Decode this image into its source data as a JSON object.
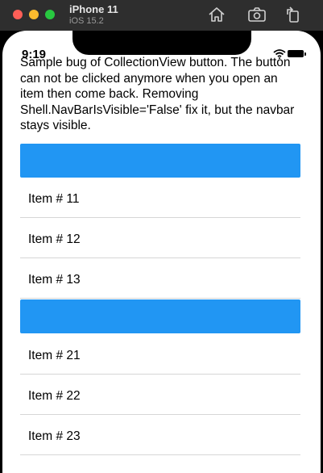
{
  "simulator": {
    "device_name": "iPhone 11",
    "os_version": "iOS 15.2",
    "toolbar_icons": [
      "home-icon",
      "screenshot-icon",
      "rotate-icon"
    ]
  },
  "status_bar": {
    "time": "9:19",
    "icons": [
      "wifi-icon",
      "battery-icon"
    ]
  },
  "page": {
    "description": "Sample bug of CollectionView button. The button can not be clicked anymore when you open an item then come back. Removing Shell.NavBarIsVisible='False' fix it, but the navbar stays visible."
  },
  "groups": [
    {
      "button_label": "",
      "items": [
        {
          "label": "Item #  11"
        },
        {
          "label": "Item #  12"
        },
        {
          "label": "Item #  13"
        }
      ]
    },
    {
      "button_label": "",
      "items": [
        {
          "label": "Item #  21"
        },
        {
          "label": "Item #  22"
        },
        {
          "label": "Item #  23"
        }
      ]
    }
  ],
  "colors": {
    "button": "#2196f3",
    "separator": "#d6d6d6",
    "titlebar": "#2e2e2e"
  }
}
